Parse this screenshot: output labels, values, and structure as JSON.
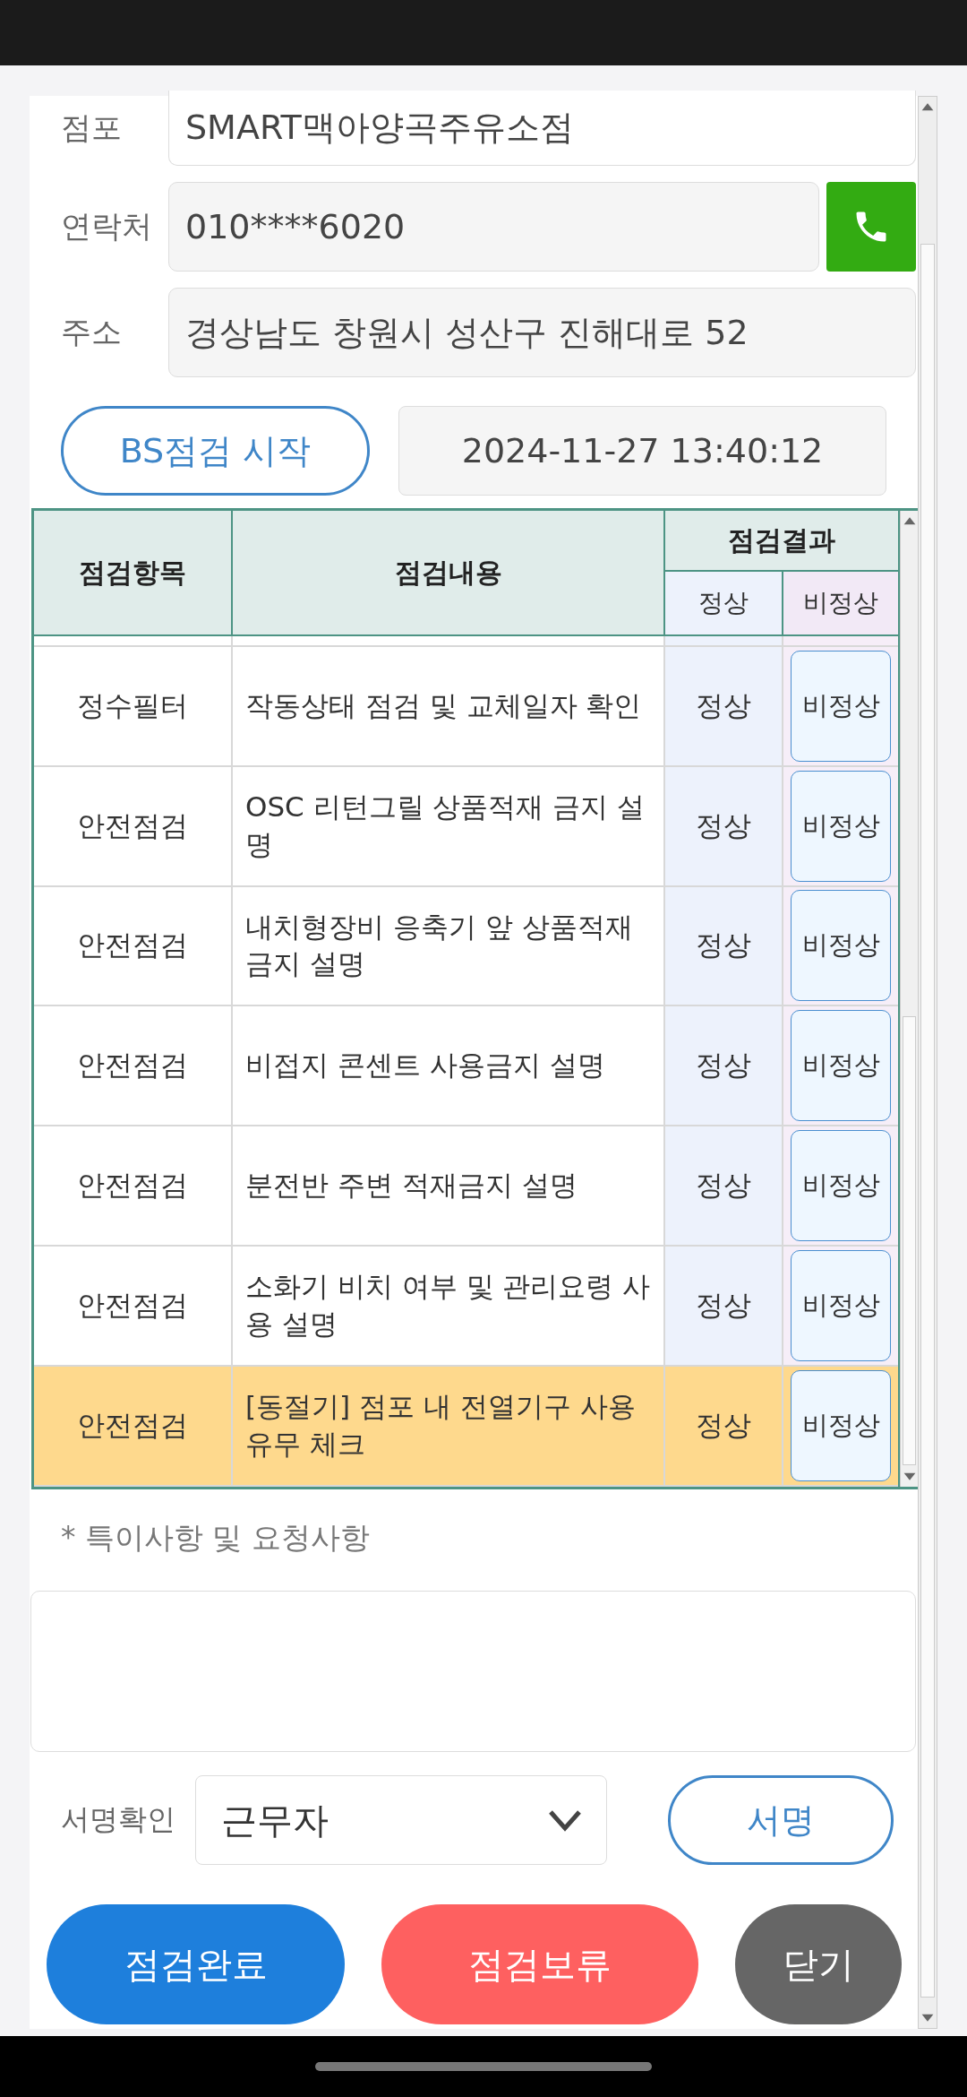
{
  "store": {
    "label": "점포",
    "value": "SMART맥아양곡주유소점"
  },
  "contact": {
    "label": "연락처",
    "value": "010****6020"
  },
  "address": {
    "label": "주소",
    "value": "경상남도 창원시 성산구 진해대로 52"
  },
  "start_button": "BS점검 시작",
  "timestamp": "2024-11-27 13:40:12",
  "table": {
    "columns": [
      "점검항목",
      "점검내용",
      "점검결과"
    ],
    "result_columns": [
      "정상",
      "비정상"
    ],
    "rows": [
      {
        "category": "정수필터",
        "content": "작동상태 점검 및 교체일자 확인",
        "normal": "정상",
        "abnormal": "비정상",
        "selected": false
      },
      {
        "category": "안전점검",
        "content": "OSC 리턴그릴 상품적재 금지 설명",
        "normal": "정상",
        "abnormal": "비정상",
        "selected": false
      },
      {
        "category": "안전점검",
        "content": "내치형장비 응축기 앞 상품적재 금지 설명",
        "normal": "정상",
        "abnormal": "비정상",
        "selected": false
      },
      {
        "category": "안전점검",
        "content": "비접지 콘센트 사용금지 설명",
        "normal": "정상",
        "abnormal": "비정상",
        "selected": false
      },
      {
        "category": "안전점검",
        "content": "분전반 주변 적재금지 설명",
        "normal": "정상",
        "abnormal": "비정상",
        "selected": false
      },
      {
        "category": "안전점검",
        "content": "소화기 비치 여부 및 관리요령 사용 설명",
        "normal": "정상",
        "abnormal": "비정상",
        "selected": false
      },
      {
        "category": "안전점검",
        "content": "[동절기] 점포 내 전열기구 사용 유무 체크",
        "normal": "정상",
        "abnormal": "비정상",
        "selected": true
      }
    ]
  },
  "notes": {
    "label": "* 특이사항 및 요청사항"
  },
  "signature": {
    "label": "서명확인",
    "value": "근무자",
    "button": "서명"
  },
  "actions": [
    {
      "label": "점검완료",
      "kind": "primary"
    },
    {
      "label": "점검보류",
      "kind": "danger"
    },
    {
      "label": "닫기",
      "kind": "neutral"
    }
  ]
}
